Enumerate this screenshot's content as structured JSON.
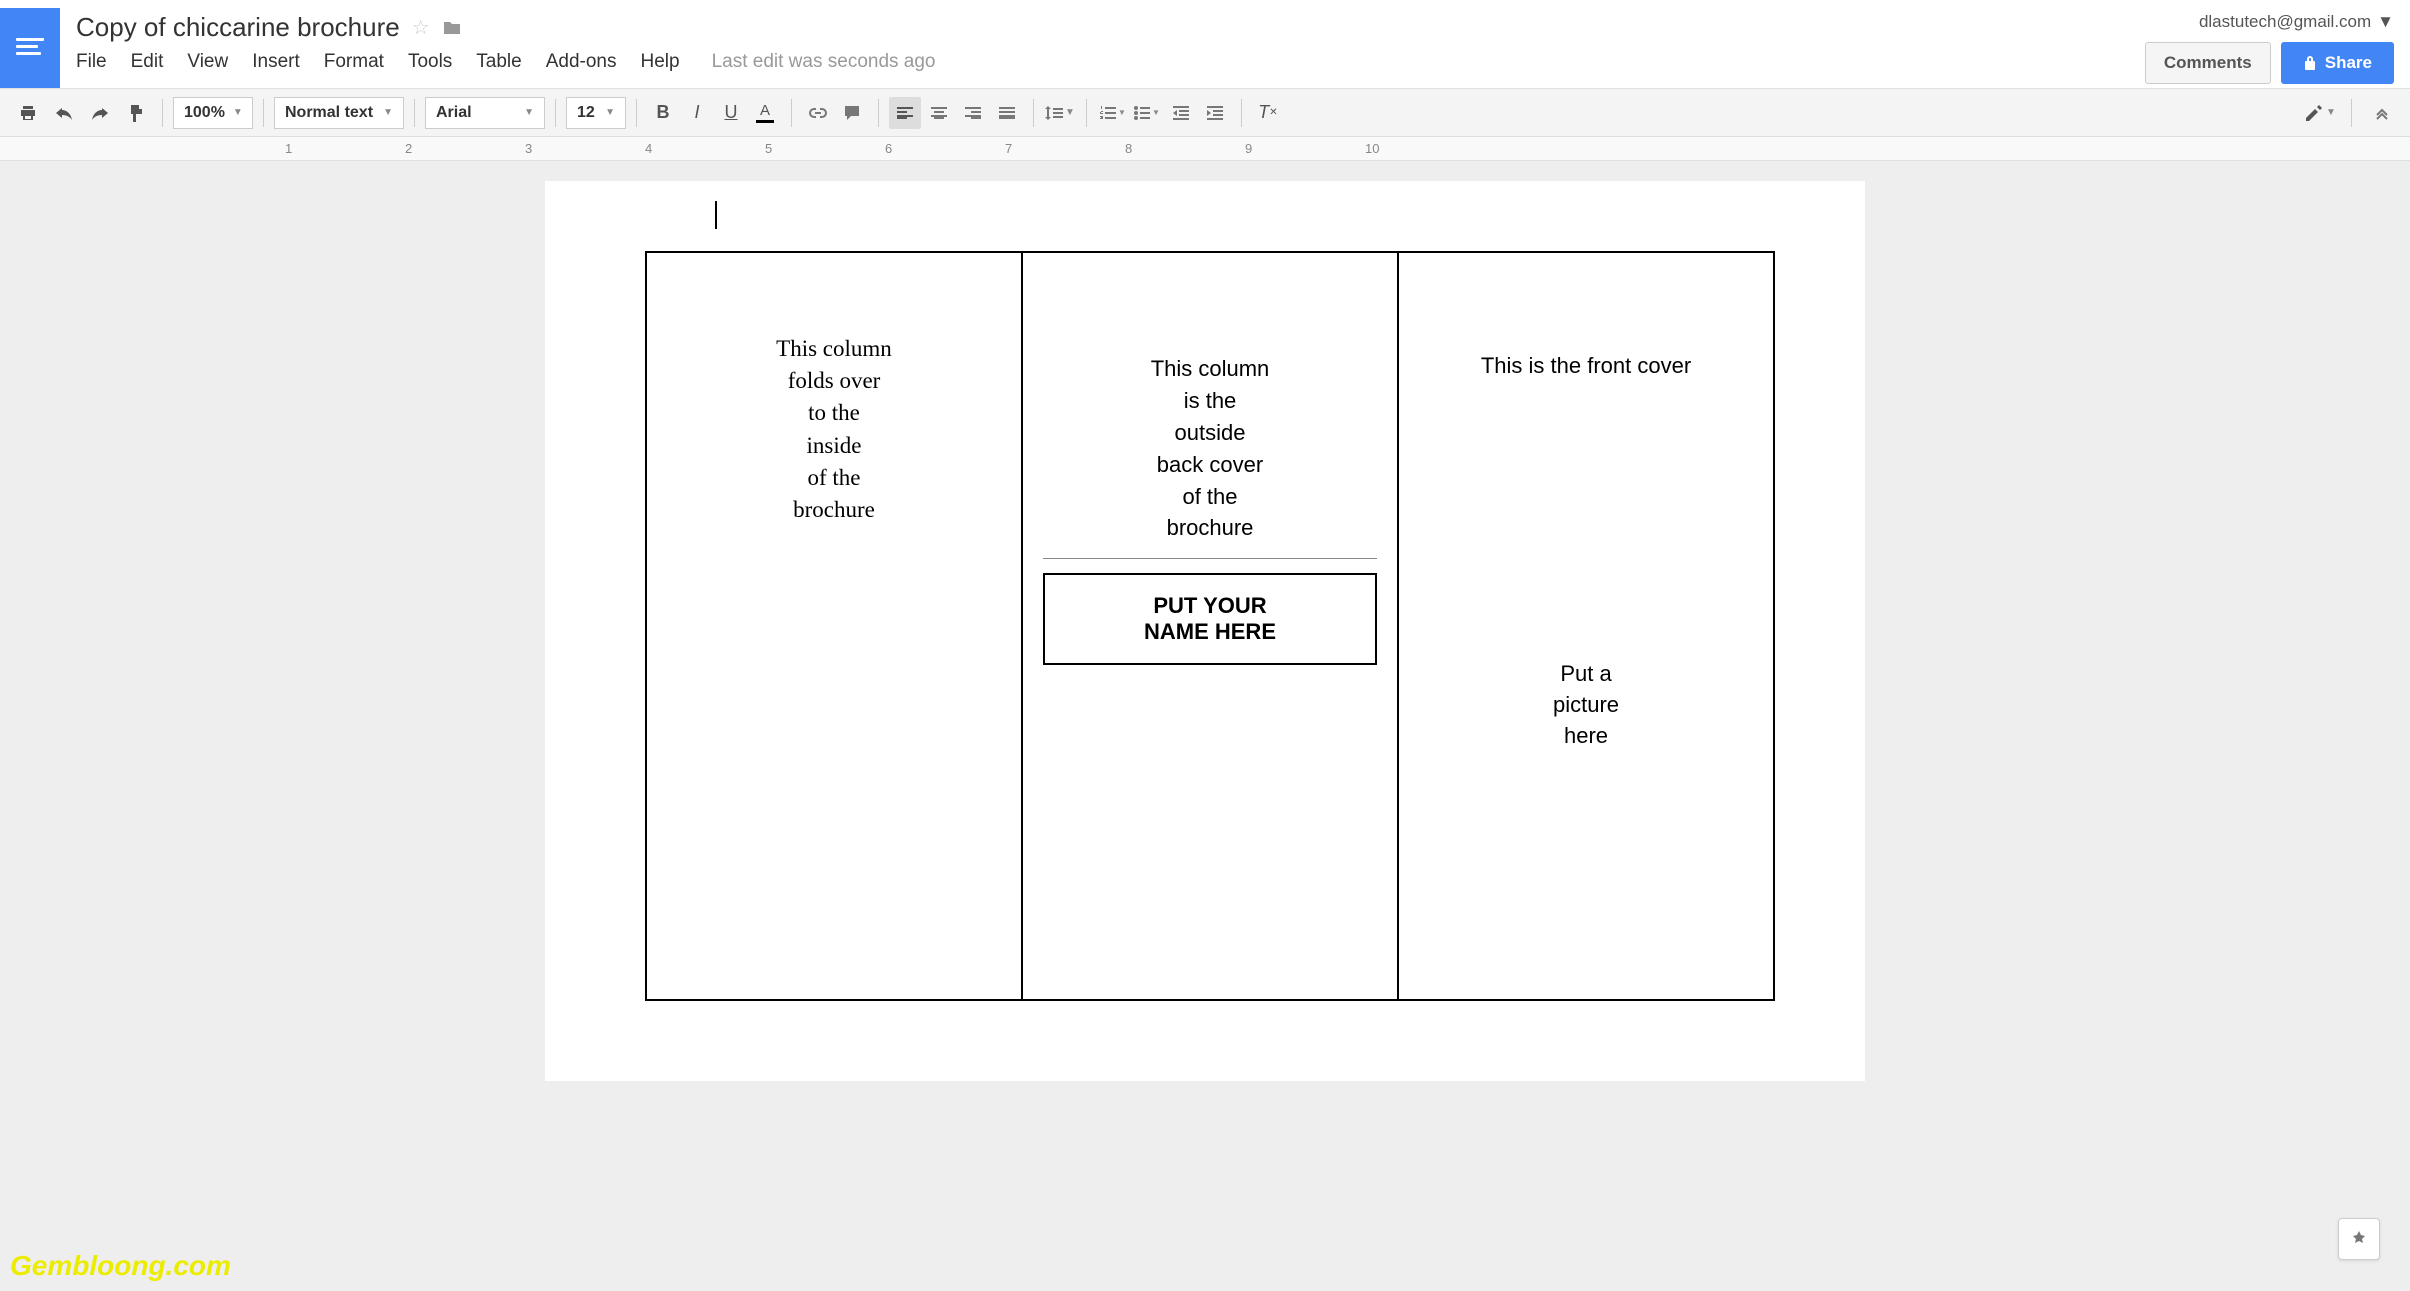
{
  "header": {
    "title": "Copy of chiccarine brochure",
    "user_email": "dlastutech@gmail.com",
    "comments_label": "Comments",
    "share_label": "Share"
  },
  "menu": {
    "items": [
      "File",
      "Edit",
      "View",
      "Insert",
      "Format",
      "Tools",
      "Table",
      "Add-ons",
      "Help"
    ],
    "last_edit": "Last edit was seconds ago"
  },
  "toolbar": {
    "zoom": "100%",
    "style": "Normal text",
    "font": "Arial",
    "size": "12"
  },
  "ruler": {
    "numbers": [
      "1",
      "2",
      "3",
      "4",
      "5",
      "6",
      "7",
      "8",
      "9",
      "10"
    ]
  },
  "document": {
    "panel1": "This column\nfolds over\nto the\ninside\nof the\nbrochure",
    "panel2": "This column\nis the\noutside\nback cover\nof the\nbrochure",
    "panel2_box": "PUT YOUR\nNAME HERE",
    "panel3_title": "This is the front cover",
    "panel3_pic": "Put a\npicture\nhere"
  },
  "watermark": "Gembloong.com"
}
